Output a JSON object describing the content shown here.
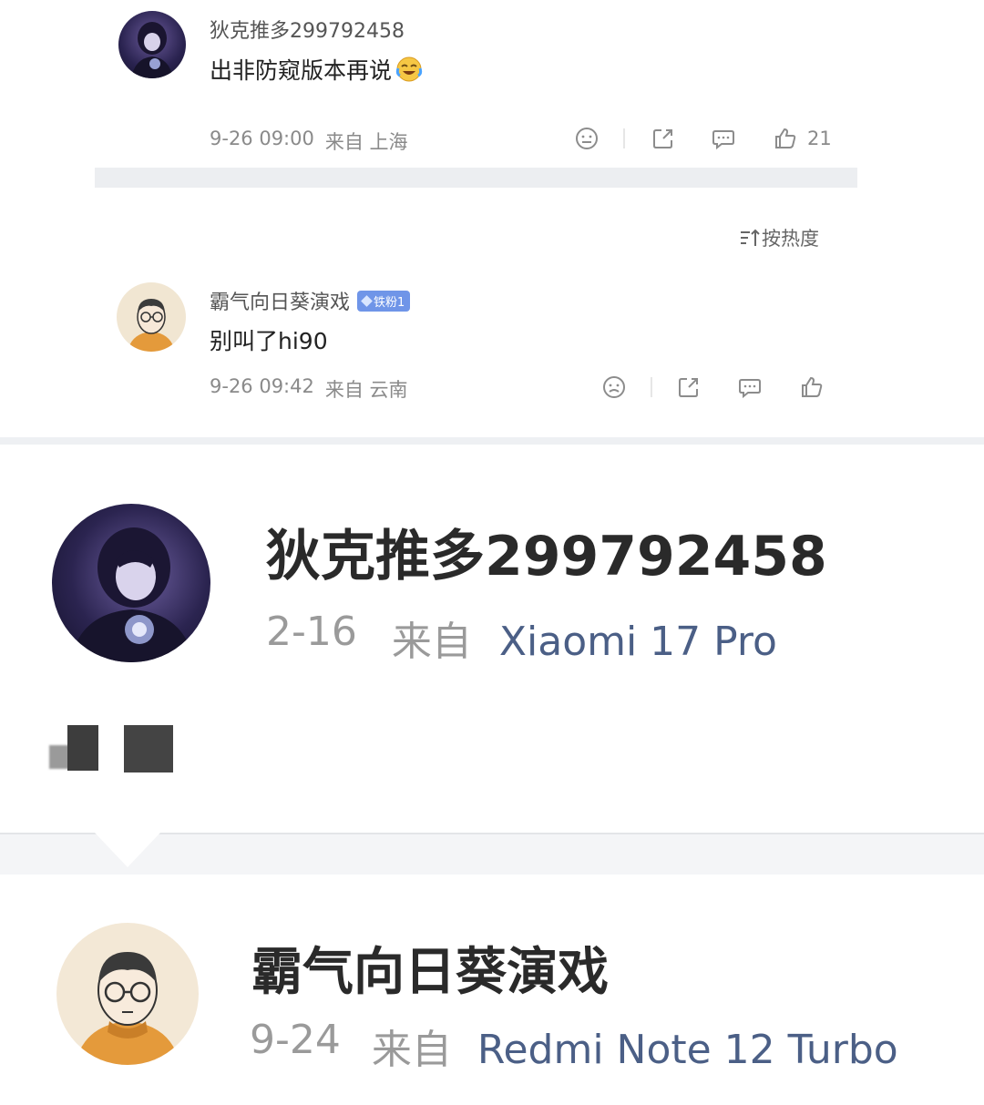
{
  "top_comment": {
    "username": "狄克推多299792458",
    "text": "出非防窥版本再说",
    "emoji_icon": "crying-laughing-emoji-icon",
    "date_time": "9-26 09:00",
    "from_label": "来自 上海",
    "like_count": "21"
  },
  "sort": {
    "label": "按热度",
    "icon": "sort-icon"
  },
  "second_comment": {
    "username": "霸气向日葵演戏",
    "badge": "铁粉1",
    "text": "别叫了hi90",
    "date_time": "9-26 09:42",
    "from_label": "来自 云南"
  },
  "profile_block_1": {
    "username": "狄克推多299792458",
    "date": "2-16",
    "from_word": "来自",
    "device": "Xiaomi 17 Pro",
    "post_icon": "blurred-image-icon"
  },
  "profile_block_2": {
    "username": "霸气向日葵演戏",
    "date": "9-24",
    "from_word": "来自",
    "device": "Redmi Note 12 Turbo"
  },
  "colors": {
    "device_link": "#4b5f86",
    "badge_bg": "#6f95e8",
    "divider": "#eceef1"
  }
}
